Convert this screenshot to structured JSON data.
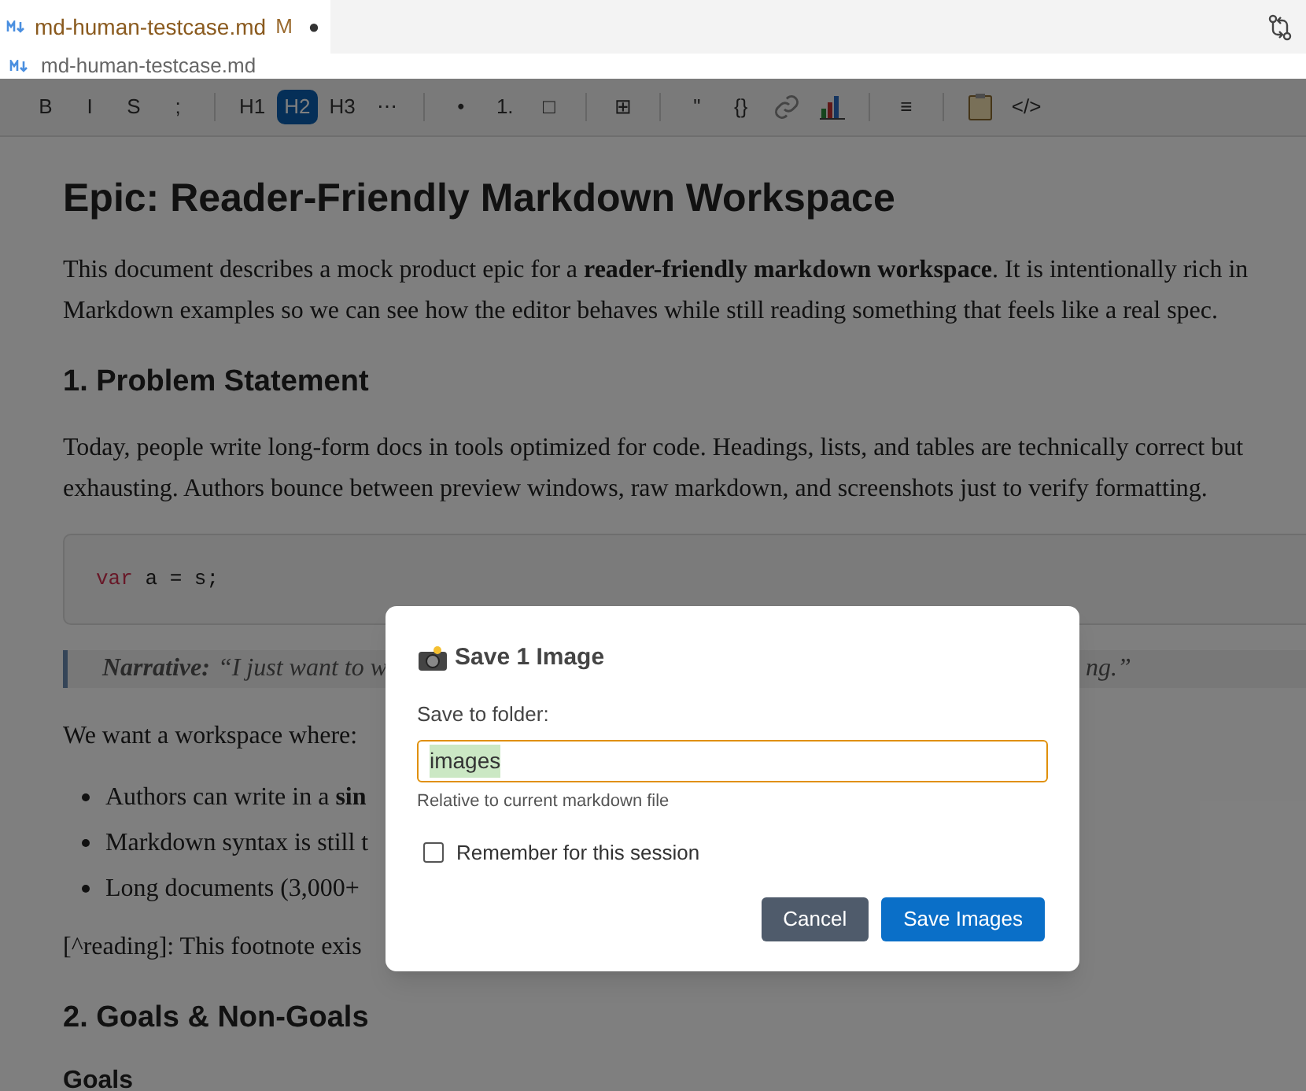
{
  "tab": {
    "title": "md-human-testcase.md",
    "status": "M",
    "dirty": "●"
  },
  "breadcrumb": "md-human-testcase.md",
  "toolbar": [
    {
      "kind": "text",
      "label": "B",
      "selected": false
    },
    {
      "kind": "text",
      "label": "I",
      "selected": false
    },
    {
      "kind": "text",
      "label": "S",
      "selected": false
    },
    {
      "kind": "text",
      "label": ";",
      "selected": false
    },
    {
      "kind": "sep"
    },
    {
      "kind": "text",
      "label": "H1",
      "selected": false
    },
    {
      "kind": "text",
      "label": "H2",
      "selected": true
    },
    {
      "kind": "text",
      "label": "H3",
      "selected": false
    },
    {
      "kind": "text",
      "label": "⋯",
      "selected": false
    },
    {
      "kind": "sep"
    },
    {
      "kind": "text",
      "label": "•",
      "selected": false
    },
    {
      "kind": "text",
      "label": "1.",
      "selected": false
    },
    {
      "kind": "text",
      "label": "□",
      "selected": false
    },
    {
      "kind": "sep"
    },
    {
      "kind": "text",
      "label": "⊞",
      "selected": false
    },
    {
      "kind": "sep"
    },
    {
      "kind": "text",
      "label": "\"",
      "selected": false
    },
    {
      "kind": "text",
      "label": "{}",
      "selected": false
    },
    {
      "kind": "link",
      "selected": false
    },
    {
      "kind": "chart",
      "selected": false
    },
    {
      "kind": "sep"
    },
    {
      "kind": "text",
      "label": "≡",
      "selected": false
    },
    {
      "kind": "sep"
    },
    {
      "kind": "clipboard",
      "selected": false
    },
    {
      "kind": "text",
      "label": "</>",
      "selected": false
    }
  ],
  "document": [
    {
      "kind": "h1",
      "text": "Epic: Reader-Friendly Markdown Workspace"
    },
    {
      "kind": "p",
      "text": "This document describes a mock product epic for a **reader-friendly markdown workspace**. It is intentionally rich in"
    },
    {
      "kind": "p",
      "text": "Markdown examples so we can see how the editor behaves while still reading something that feels like a real spec."
    },
    {
      "kind": "h2",
      "text": "1. Problem Statement"
    },
    {
      "kind": "p",
      "text": "Today, people write long-form docs in tools optimized for code. Headings, lists, and tables are technically correct but"
    },
    {
      "kind": "p",
      "text": "exhausting. Authors bounce between preview windows, raw markdown, and screenshots just to verify formatting."
    },
    {
      "kind": "code",
      "keyword": "var",
      "text": "a = s;"
    },
    {
      "kind": "quote",
      "label": "Narrative:",
      "start": "“I just want to w",
      "end": "ng.”"
    },
    {
      "kind": "p",
      "text": "We want a workspace where:"
    },
    {
      "kind": "li",
      "text": "Authors can write in a **sin**"
    },
    {
      "kind": "li",
      "text": "Markdown syntax is still t"
    },
    {
      "kind": "li",
      "text": "Long documents (3,000+"
    },
    {
      "kind": "p",
      "text": "[^reading]: This footnote exis"
    },
    {
      "kind": "h2",
      "text": "2. Goals & Non-Goals"
    },
    {
      "kind": "h3",
      "text": "Goals"
    }
  ],
  "dialog": {
    "title": "Save 1 Image",
    "field_label": "Save to folder:",
    "value": "images",
    "hint": "Relative to current markdown file",
    "checkbox": {
      "label": "Remember for this session",
      "checked": false
    },
    "buttons": [
      {
        "kind": "secondary",
        "label": "Cancel"
      },
      {
        "kind": "primary",
        "label": "Save Images"
      }
    ]
  }
}
